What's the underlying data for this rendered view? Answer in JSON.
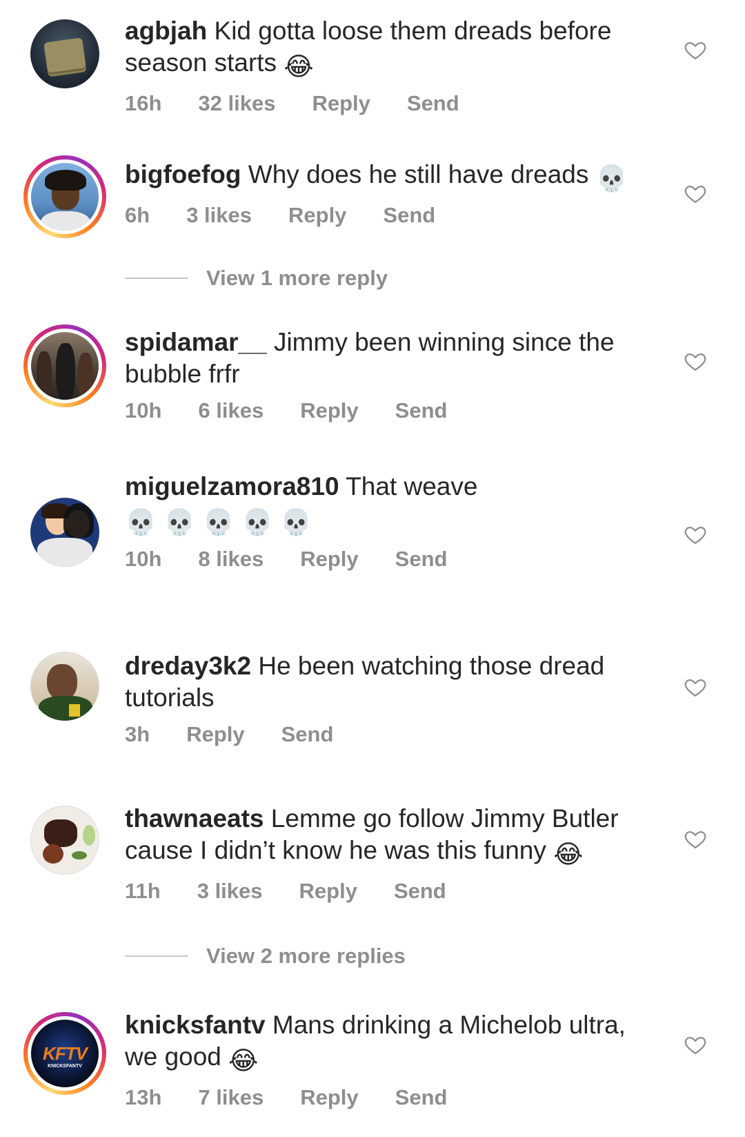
{
  "comments": [
    {
      "username": "agbjah",
      "text": "Kid gotta loose them dreads before season starts",
      "emoji": "😂",
      "time": "16h",
      "likes": "32 likes",
      "reply": "Reply",
      "send": "Send"
    },
    {
      "username": "bigfoefog",
      "text": "Why does he still have dreads",
      "emoji": "💀",
      "time": "6h",
      "likes": "3 likes",
      "reply": "Reply",
      "send": "Send"
    },
    {
      "username": "spidamar__",
      "text": "Jimmy been winning since the bubble frfr",
      "time": "10h",
      "likes": "6 likes",
      "reply": "Reply",
      "send": "Send"
    },
    {
      "username": "miguelzamora810",
      "text": "That weave",
      "emoji": "💀 💀 💀 💀 💀",
      "time": "10h",
      "likes": "8 likes",
      "reply": "Reply",
      "send": "Send"
    },
    {
      "username": "dreday3k2",
      "text": "He been watching those dread tutorials",
      "time": "3h",
      "reply": "Reply",
      "send": "Send"
    },
    {
      "username": "thawnaeats",
      "text": "Lemme go follow Jimmy Butler cause I didn’t know he was this funny",
      "emoji": "😂",
      "time": "11h",
      "likes": "3 likes",
      "reply": "Reply",
      "send": "Send"
    },
    {
      "username": "knicksfantv",
      "text": "Mans drinking a Michelob ultra, we good",
      "emoji": "😂",
      "time": "13h",
      "likes": "7 likes",
      "reply": "Reply",
      "send": "Send",
      "avatar_text": "KFTV",
      "avatar_subtext": "KNICKSFANTV"
    }
  ],
  "view_more": [
    {
      "label": "View 1 more reply"
    },
    {
      "label": "View 2 more replies"
    }
  ],
  "icons": {
    "like": "heart-outline-icon"
  },
  "colors": {
    "text": "#262626",
    "meta": "#8e8e8e",
    "story_ring": "#d62976"
  }
}
